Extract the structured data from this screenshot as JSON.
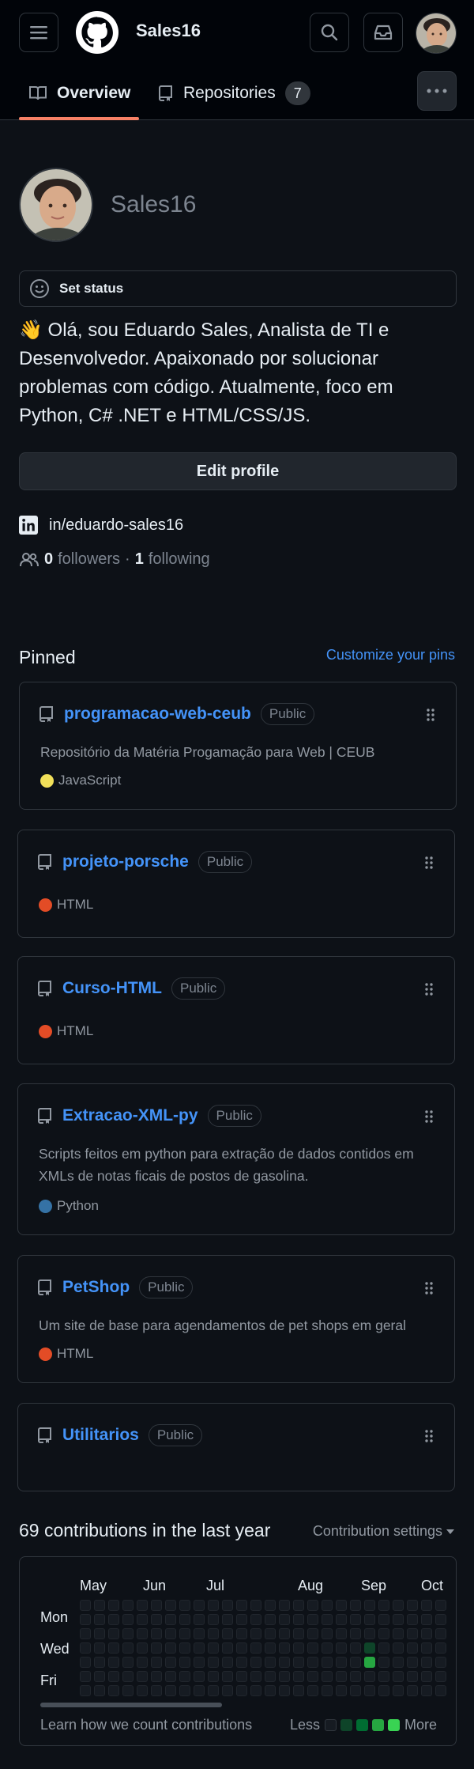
{
  "header": {
    "username": "Sales16"
  },
  "tabs": [
    {
      "label": "Overview",
      "icon": "book-icon"
    },
    {
      "label": "Repositories",
      "icon": "repo-icon",
      "count": "7"
    }
  ],
  "profile": {
    "name": "Sales16",
    "set_status": "Set status",
    "bio": "👋 Olá, sou Eduardo Sales, Analista de TI e Desenvolvedor. Apaixonado por solucionar problemas com código. Atualmente, foco em Python, C# .NET e HTML/CSS/JS.",
    "edit_profile": "Edit profile",
    "linkedin": "in/eduardo-sales16",
    "followers_count": "0",
    "followers_label": "followers",
    "separator": "·",
    "following_count": "1",
    "following_label": "following"
  },
  "pinned": {
    "title": "Pinned",
    "customize": "Customize your pins",
    "repos": [
      {
        "name": "programacao-web-ceub",
        "visibility": "Public",
        "description": "Repositório da Matéria Progamação para Web | CEUB",
        "language": "JavaScript",
        "language_color": "#f1e05a"
      },
      {
        "name": "projeto-porsche",
        "visibility": "Public",
        "description": "",
        "language": "HTML",
        "language_color": "#e34c26"
      },
      {
        "name": "Curso-HTML",
        "visibility": "Public",
        "description": "",
        "language": "HTML",
        "language_color": "#e34c26"
      },
      {
        "name": "Extracao-XML-py",
        "visibility": "Public",
        "description": "Scripts feitos em python para extração de dados contidos em XMLs de notas ficais de postos de gasolina.",
        "language": "Python",
        "language_color": "#3572A5"
      },
      {
        "name": "PetShop",
        "visibility": "Public",
        "description": "Um site de base para agendamentos de pet shops em geral",
        "language": "HTML",
        "language_color": "#e34c26"
      },
      {
        "name": "Utilitarios",
        "visibility": "Public",
        "description": "",
        "language": "",
        "language_color": ""
      }
    ]
  },
  "contributions": {
    "title": "69 contributions in the last year",
    "settings": "Contribution settings",
    "months": [
      "May",
      "Jun",
      "Jul",
      "Aug",
      "Sep",
      "Oct"
    ],
    "days": [
      "Mon",
      "Wed",
      "Fri"
    ],
    "learn": "Learn how we count contributions",
    "less": "Less",
    "more": "More",
    "legend_colors": [
      "#161b22",
      "#0e4429",
      "#006d32",
      "#26a641",
      "#39d353"
    ]
  }
}
